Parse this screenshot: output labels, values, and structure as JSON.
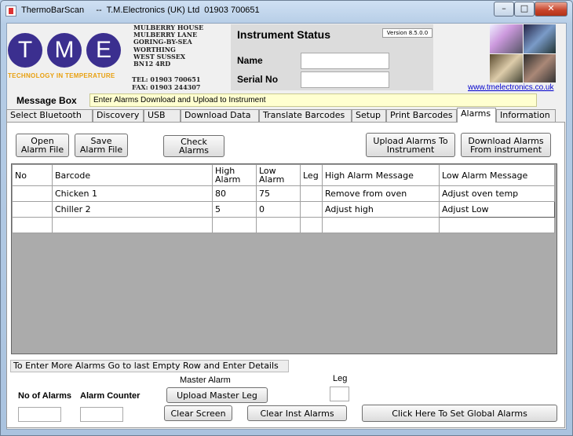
{
  "window": {
    "app_name": "ThermoBarScan",
    "title_suffix": "--  T.M.Electronics (UK) Ltd  01903 700651",
    "controls": {
      "minimize": "–",
      "maximize": "□",
      "close": "✕"
    }
  },
  "header": {
    "logo_letters": [
      "T",
      "M",
      "E"
    ],
    "tagline": "TECHNOLOGY IN TEMPERATURE",
    "address_lines": [
      "MULBERRY HOUSE",
      "MULBERRY LANE",
      "GORING-BY-SEA",
      "WORTHING",
      "WEST SUSSEX",
      "BN12 4RD"
    ],
    "tel": "TEL:  01903 700651",
    "fax": "FAX:  01903 244307",
    "url": "www.tmelectronics.co.uk"
  },
  "status": {
    "title": "Instrument Status",
    "version": "Version 8.5.0.0",
    "name_label": "Name",
    "name_value": "",
    "serial_label": "Serial No",
    "serial_value": ""
  },
  "message": {
    "label": "Message Box",
    "text": "Enter Alarms Download and Upload to Instrument"
  },
  "tabs": [
    {
      "label": "Select  Bluetooth"
    },
    {
      "label": "Discovery"
    },
    {
      "label": "USB"
    },
    {
      "label": "Download Data"
    },
    {
      "label": "Translate Barcodes"
    },
    {
      "label": "Setup"
    },
    {
      "label": "Print Barcodes"
    },
    {
      "label": "Alarms",
      "active": true
    },
    {
      "label": "Information"
    }
  ],
  "toolbar": {
    "open": "Open\nAlarm File",
    "save": "Save\nAlarm File",
    "check": "Check\nAlarms",
    "upload": "Upload Alarms To\nInstrument",
    "download": "Download Alarms\nFrom instrument"
  },
  "grid": {
    "headers": [
      "No",
      "Barcode",
      "High\nAlarm",
      "Low\nAlarm",
      "Leg",
      "High Alarm Message",
      "Low Alarm Message"
    ],
    "rows": [
      [
        "",
        "Chicken 1",
        "80",
        "75",
        "",
        "Remove from oven",
        "Adjust oven temp"
      ],
      [
        "",
        "Chiller 2",
        "5",
        "0",
        "",
        "Adjust high",
        "Adjust Low"
      ],
      [
        "",
        "",
        "",
        "",
        "",
        "",
        ""
      ]
    ]
  },
  "footer": {
    "hint": "To Enter More Alarms Go to last Empty Row and Enter Details",
    "no_of_alarms_label": "No of Alarms",
    "no_of_alarms_value": "",
    "alarm_counter_label": "Alarm Counter",
    "alarm_counter_value": "",
    "master_alarm_label": "Master Alarm",
    "upload_master_leg": "Upload Master Leg",
    "leg_label": "Leg",
    "leg_value": "",
    "clear_screen": "Clear Screen",
    "clear_inst_alarms": "Clear Inst Alarms",
    "global_alarms": "Click Here To Set Global Alarms"
  }
}
